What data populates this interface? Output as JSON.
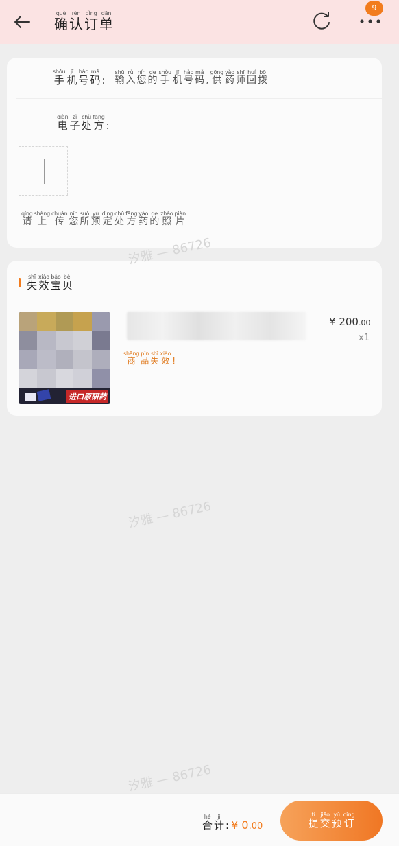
{
  "header": {
    "title": [
      [
        "què",
        "确"
      ],
      [
        "rèn",
        "认"
      ],
      [
        "dìng",
        "订"
      ],
      [
        "dān",
        "单"
      ]
    ],
    "badge_count": "9",
    "back_icon": "arrow-left-icon",
    "refresh_icon": "refresh-icon",
    "more_icon": "more-dots-icon"
  },
  "form": {
    "phone_label": [
      [
        "shǒu",
        "手"
      ],
      [
        "jī",
        "机"
      ],
      [
        "hào",
        "号"
      ],
      [
        "mǎ",
        "码"
      ],
      [
        "",
        ":"
      ]
    ],
    "phone_placeholder": [
      [
        "shū",
        "输"
      ],
      [
        "rù",
        "入"
      ],
      [
        "nín",
        "您"
      ],
      [
        "de",
        "的"
      ],
      [
        "shǒu",
        "手"
      ],
      [
        "jī",
        "机"
      ],
      [
        "hào",
        "号"
      ],
      [
        "mǎ",
        "码"
      ],
      [
        "",
        ","
      ],
      [
        "gōng",
        "供"
      ],
      [
        "yào",
        "药"
      ],
      [
        "shī",
        "师"
      ],
      [
        "huí",
        "回"
      ],
      [
        "bō",
        "拨"
      ]
    ],
    "rx_label": [
      [
        "diàn",
        "电"
      ],
      [
        "zǐ",
        "子"
      ],
      [
        "chǔ",
        "处"
      ],
      [
        "fāng",
        "方"
      ],
      [
        "",
        ":"
      ]
    ],
    "upload_hint": [
      [
        "qǐng",
        "请"
      ],
      [
        "shàng",
        "上"
      ],
      [
        "chuán",
        "传"
      ],
      [
        "nín",
        "您"
      ],
      [
        "suǒ",
        "所"
      ],
      [
        "yù",
        "预"
      ],
      [
        "dìng",
        "定"
      ],
      [
        "chǔ",
        "处"
      ],
      [
        "fāng",
        "方"
      ],
      [
        "yào",
        "药"
      ],
      [
        "de",
        "的"
      ],
      [
        "zhào",
        "照"
      ],
      [
        "piàn",
        "片"
      ]
    ]
  },
  "invalid_section": {
    "title": [
      [
        "shī",
        "失"
      ],
      [
        "xiào",
        "效"
      ],
      [
        "bǎo",
        "宝"
      ],
      [
        "bèi",
        "贝"
      ]
    ],
    "product": {
      "image_tag": "进口原研药",
      "price_symbol": "¥",
      "price_int": "200",
      "price_dec": ".00",
      "qty": "x1",
      "status": [
        [
          "shāng",
          "商"
        ],
        [
          "pǐn",
          "品"
        ],
        [
          "shī",
          "失"
        ],
        [
          "xiào",
          "效"
        ],
        [
          "",
          "!"
        ]
      ]
    }
  },
  "watermark": "汐雅 — 86726",
  "footer": {
    "total_label": [
      [
        "hé",
        "合"
      ],
      [
        "jì",
        "计"
      ],
      [
        "",
        ":"
      ]
    ],
    "currency": "¥",
    "total_int": "0",
    "total_dec": ".00",
    "submit_label": [
      [
        "tí",
        "提"
      ],
      [
        "jiāo",
        "交"
      ],
      [
        "yù",
        "预"
      ],
      [
        "dìng",
        "订"
      ]
    ]
  },
  "colors": {
    "accent": "#f27c1e",
    "header_bg": "#fbe3e3",
    "page_bg": "#eeeeee"
  }
}
